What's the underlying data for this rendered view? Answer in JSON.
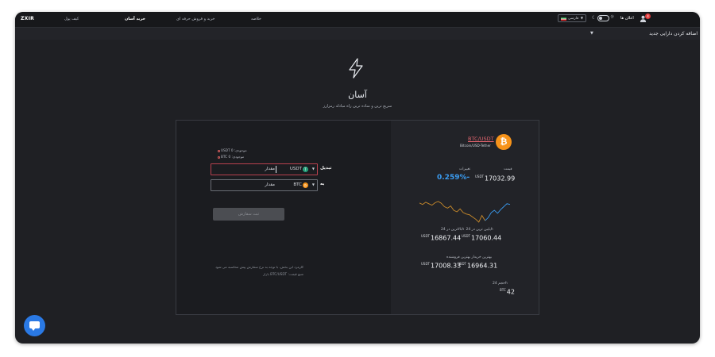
{
  "header": {
    "logo": "ZXIR",
    "nav": [
      "کیف پول",
      "خرید آسان",
      "خرید و فروش حرفه ای",
      "خلاصه"
    ],
    "language": "فارسی",
    "notifications_label": "اعلان ها",
    "notification_count": "4"
  },
  "subbar": {
    "add_asset_label": "اضافه کردن دارایی جدید"
  },
  "hero": {
    "title": "آسان",
    "subtitle": "سریع ترین و ساده ترین راه مبادله رمزارز"
  },
  "exchange": {
    "inventory_usdt": "USDT موجودی: 0",
    "inventory_btc": "BTC موجودی: 0",
    "convert_label": "تبدیل",
    "to_label": "به",
    "from_coin": "USDT",
    "to_coin": "BTC",
    "amount_placeholder": "مقدار",
    "submit_label": "ثبت سفارش",
    "note_line1": "کارمزد این بخش، با توجه به نرخ سفارش پیش محاسبه می شود",
    "note_line2": "منبع قیمت: BTC/USDT بازار"
  },
  "market": {
    "pair": "BTC/USDT",
    "pair_name": "Bitcoin/USD-Tether",
    "price_label": "قیمت",
    "price_unit": "USDT",
    "price": "17032.99",
    "change_label": "تغییرات",
    "change": "0.259%-",
    "range_label": "بالاترین در 24h   پایین ترین در 24h",
    "high_24h": "17060.44",
    "low_24h": "16867.44",
    "bid_ask_label": "بهترین خریدار   بهترین فروشنده",
    "best_seller": "16964.31",
    "best_buyer": "17008.33",
    "volume_label": "حجم 24h",
    "volume_unit": "BTC",
    "volume": "42",
    "colors": {
      "accent": "#3a9bf0",
      "spark_down": "#c98a2a",
      "spark_up": "#3a9bf0",
      "btc": "#f7931a",
      "usdt": "#26a17b"
    }
  },
  "chart_data": {
    "type": "line",
    "title": "",
    "xlabel": "",
    "ylabel": "",
    "series": [
      {
        "values": [
          17010,
          17000,
          17015,
          17005,
          16995,
          17012,
          17020,
          17008,
          16985,
          16975,
          16990,
          16960,
          16950,
          16970,
          16945,
          16935,
          16930,
          16915,
          16900,
          16880,
          16925,
          16890,
          16910,
          16945,
          16960,
          16940,
          16965,
          16985,
          17005,
          17000
        ]
      }
    ],
    "grid": false
  }
}
